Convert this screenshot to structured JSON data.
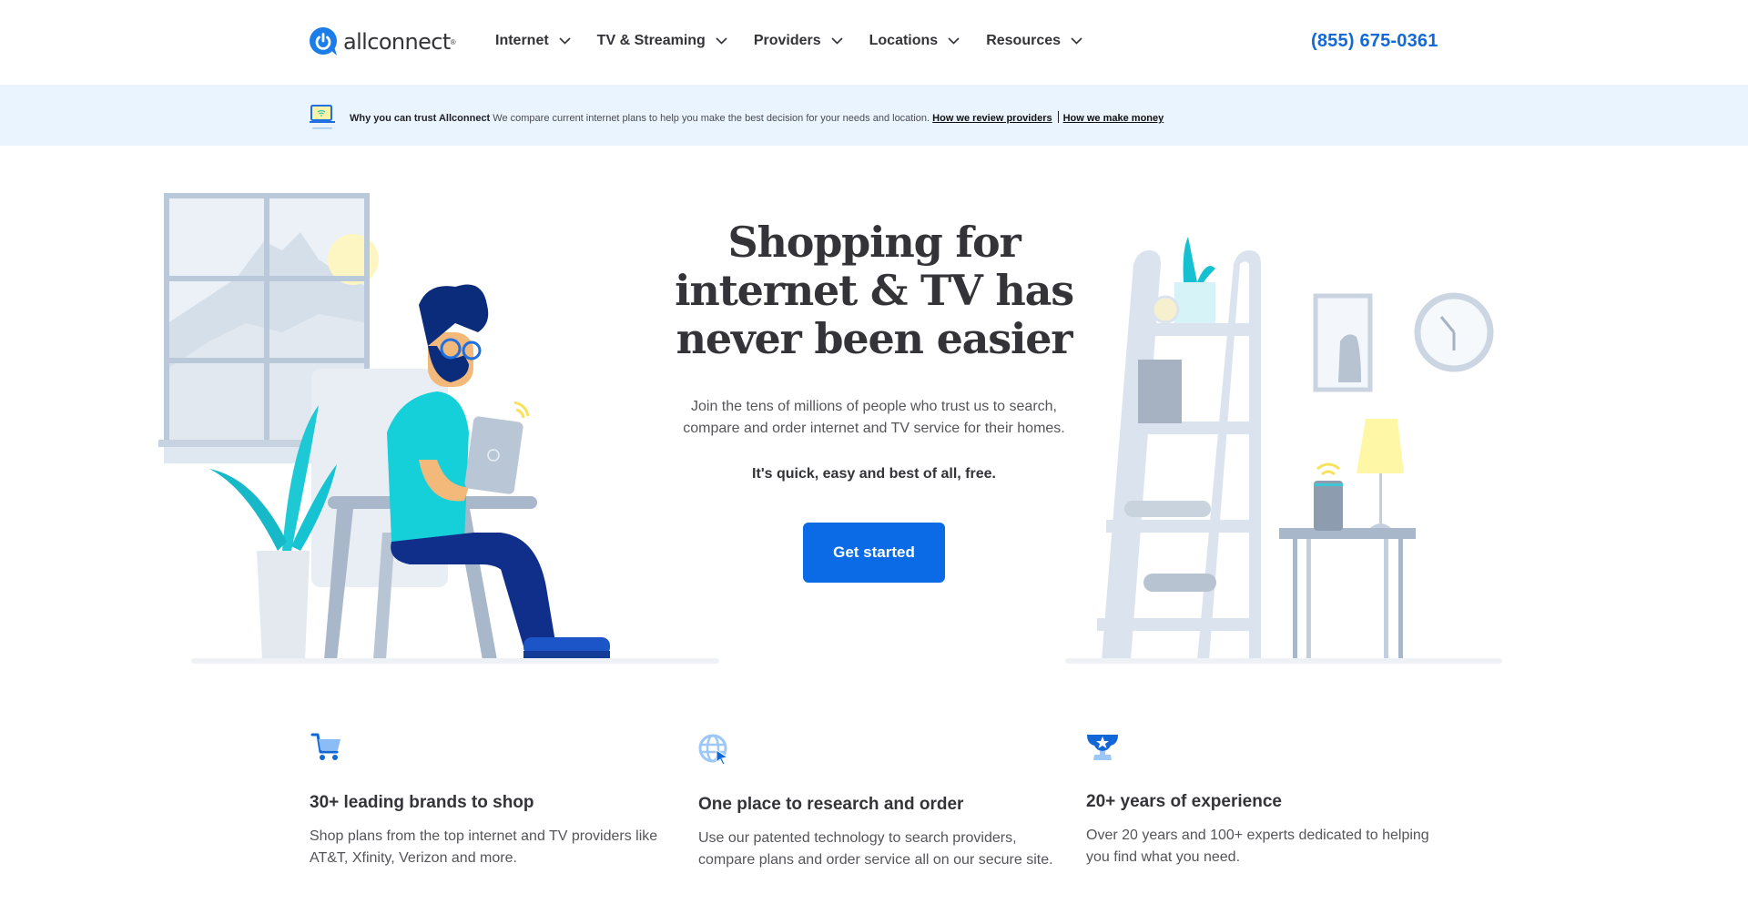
{
  "header": {
    "logo_text": "allconnect",
    "logo_reg": "®",
    "nav": [
      {
        "label": "Internet"
      },
      {
        "label": "TV & Streaming"
      },
      {
        "label": "Providers"
      },
      {
        "label": "Locations"
      },
      {
        "label": "Resources"
      }
    ],
    "phone": "(855) 675-0361"
  },
  "trust_banner": {
    "title": "Why you can trust Allconnect",
    "text": "We compare current internet plans to help you make the best decision for your needs and location.",
    "link1": "How we review providers",
    "link2": "How we make money"
  },
  "hero": {
    "title_line1": "Shopping for",
    "title_line2": "internet & TV has",
    "title_line3": "never been easier",
    "sub_line1": "Join the tens of millions of people who trust us to search,",
    "sub_line2": "compare and order internet and TV service for their homes.",
    "strong": "It's quick, easy and best of all, free.",
    "cta": "Get started"
  },
  "features": [
    {
      "icon": "cart-icon",
      "title": "30+ leading brands to shop",
      "line1": "Shop plans from the top internet and TV providers like",
      "line2": "AT&T, Xfinity, Verizon and more."
    },
    {
      "icon": "globe-cursor-icon",
      "title": "One place to research and order",
      "line1": "Use our patented technology to search providers,",
      "line2": "compare plans and order service all on our secure site."
    },
    {
      "icon": "trophy-icon",
      "title": "20+ years of experience",
      "line1": "Over 20 years and 100+ experts dedicated to helping",
      "line2": "you find what you need."
    }
  ],
  "colors": {
    "brand_blue": "#0b6ae6",
    "phone_blue": "#1469d8",
    "banner_bg": "#eaf4fe",
    "text_dark": "#333338"
  }
}
